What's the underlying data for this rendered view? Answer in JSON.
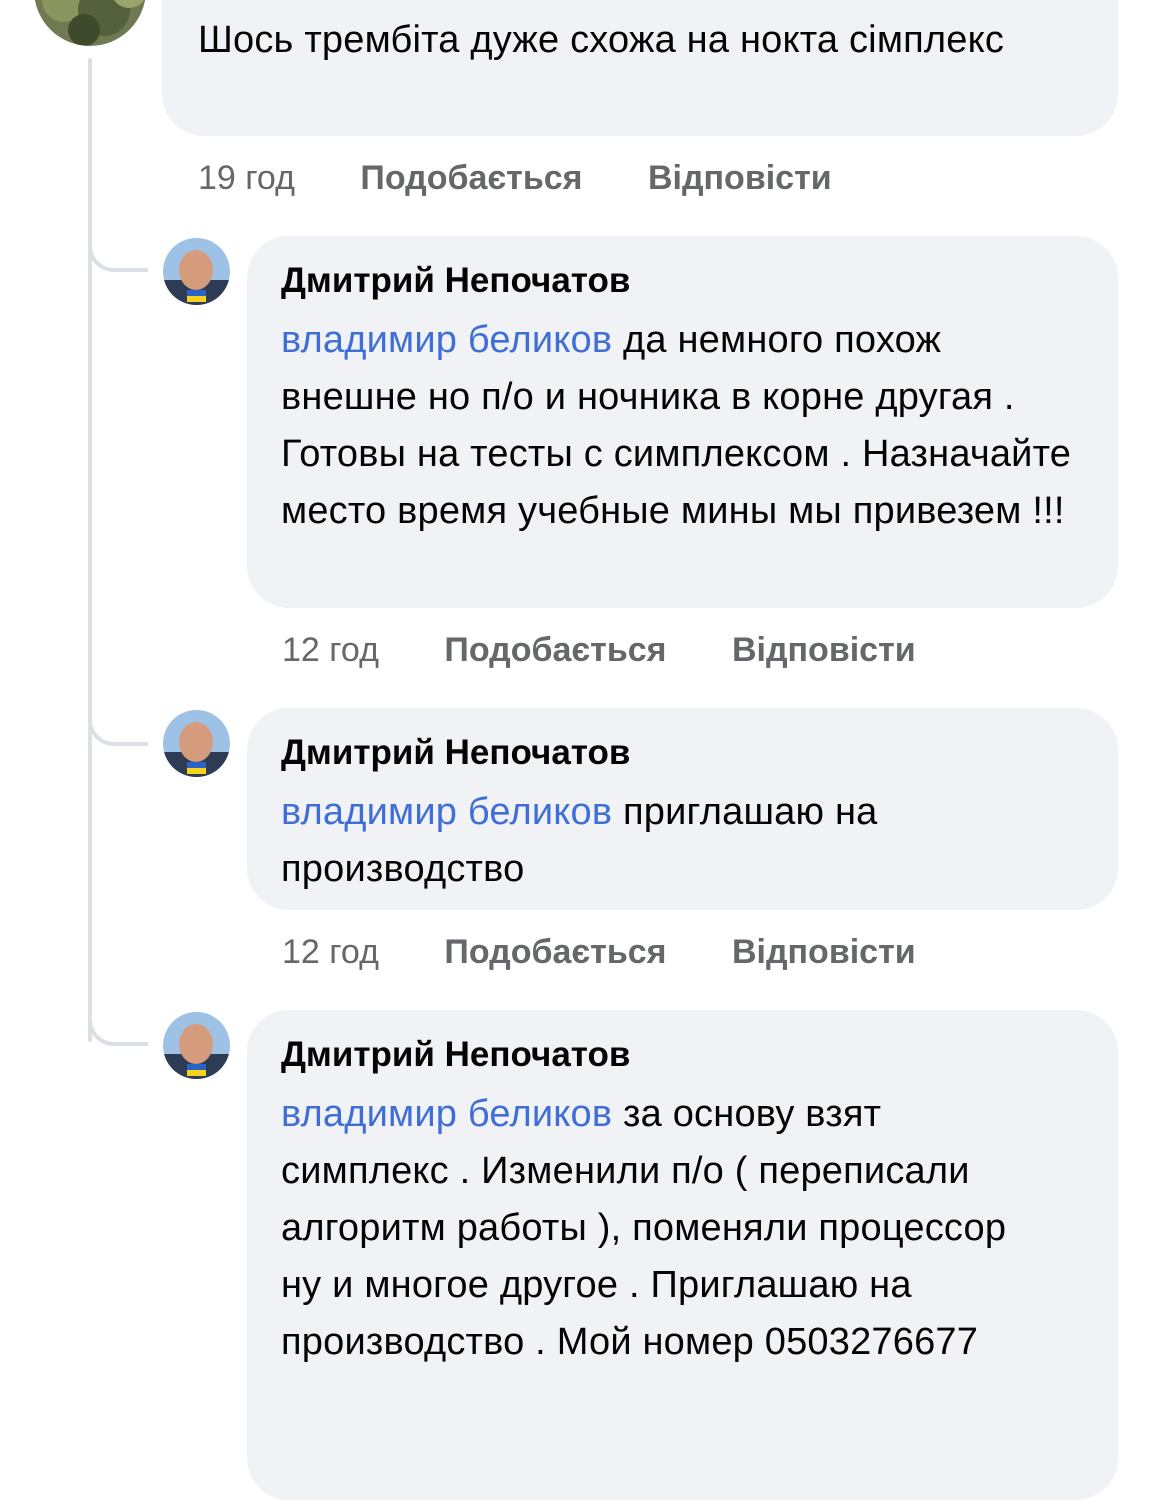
{
  "parent_comment": {
    "text": "Шось трембіта дуже схожа на нокта сімплекс",
    "time": "19 год",
    "like_label": "Подобається",
    "reply_label": "Відповісти"
  },
  "replies": [
    {
      "author": "Дмитрий Непочатов",
      "mention": "владимир беликов",
      "text": " да немного похож внешне но п/о и ночника в корне другая . Готовы на тесты с симплексом . Назначайте место время учебные мины мы привезем !!!",
      "time": "12 год",
      "like_label": "Подобається",
      "reply_label": "Відповісти"
    },
    {
      "author": "Дмитрий Непочатов",
      "mention": "владимир беликов",
      "text": " приглашаю на производство",
      "time": "12 год",
      "like_label": "Подобається",
      "reply_label": "Відповісти"
    },
    {
      "author": "Дмитрий Непочатов",
      "mention": "владимир беликов",
      "text": " за основу взят симплекс . Изменили п/о ( переписали алгоритм работы ), поменяли процессор ну и многое другое . Приглашаю на производство . Мой номер 0503276677"
    }
  ],
  "colors": {
    "mention": "#3f6fd6",
    "bubble": "#f0f2f5",
    "meta_text": "#65676b",
    "thread_line": "#dcdfe3"
  }
}
